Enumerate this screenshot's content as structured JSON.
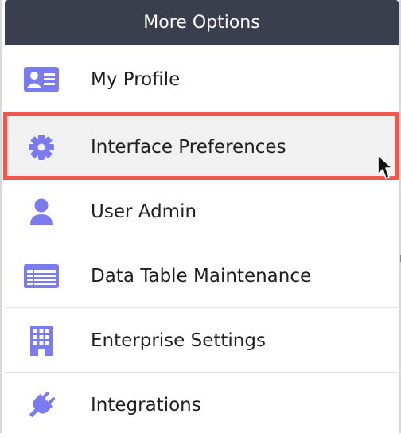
{
  "menu": {
    "title": "More Options",
    "accent_color": "#7b7bf0",
    "highlight_color": "#f0584f",
    "items": [
      {
        "label": "My Profile",
        "icon": "profile-card-icon"
      },
      {
        "label": "Interface Preferences",
        "icon": "gear-icon",
        "highlighted": true
      },
      {
        "label": "User Admin",
        "icon": "user-icon"
      },
      {
        "label": "Data Table Maintenance",
        "icon": "table-icon"
      },
      {
        "label": "Enterprise Settings",
        "icon": "building-icon"
      },
      {
        "label": "Integrations",
        "icon": "plug-icon"
      }
    ]
  }
}
